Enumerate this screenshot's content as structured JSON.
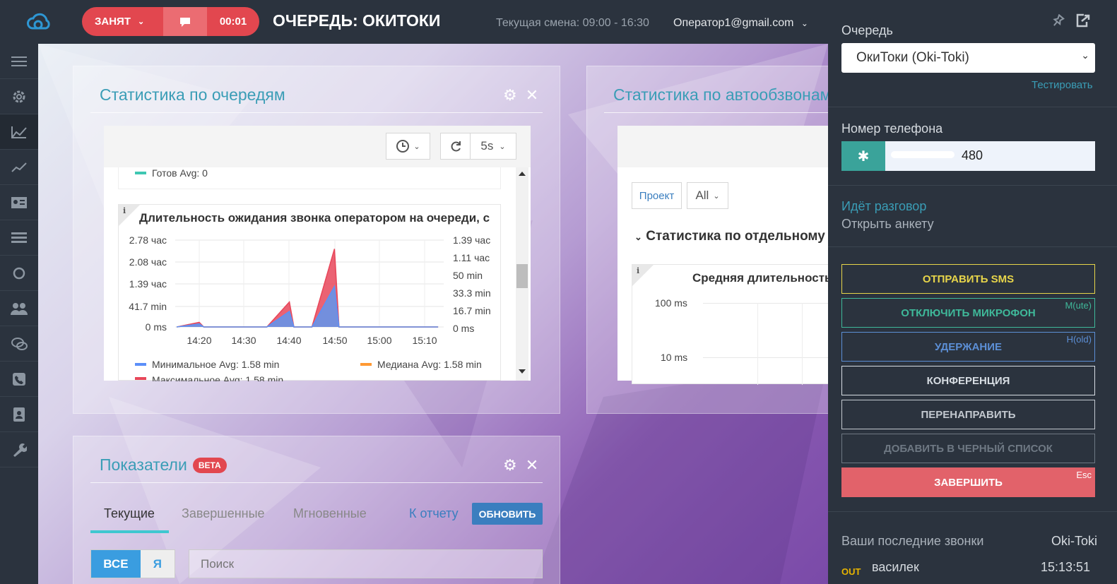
{
  "header": {
    "status_label": "ЗАНЯТ",
    "timer": "00:01",
    "queue_title": "ОЧЕРЕДЬ: ОКИТОКИ",
    "shift": "Текущая смена: 09:00 - 16:30",
    "user_email": "Оператор1@gmail.com"
  },
  "sidebar": {
    "items": [
      "menu-icon",
      "gear-icon",
      "area-chart-icon",
      "line-chart-icon",
      "id-card-icon",
      "list-icon",
      "circle-icon",
      "users-icon",
      "chat-icon",
      "phone-icon",
      "contact-book-icon",
      "wrench-icon"
    ]
  },
  "queue_stats": {
    "title": "Статистика по очередям",
    "refresh_interval": "5s",
    "ready_legend": "Готов  Avg: 0",
    "graph_title": "Длительность ожидания звонка оператором на очереди, с",
    "left_ticks": [
      "2.78 час",
      "2.08 час",
      "1.39 час",
      "41.7 min",
      "0 ms"
    ],
    "right_ticks": [
      "1.39 час",
      "1.11 час",
      "50 min",
      "33.3 min",
      "16.7 min",
      "0 ms"
    ],
    "x_ticks": [
      "14:20",
      "14:30",
      "14:40",
      "14:50",
      "15:00",
      "15:10"
    ],
    "legend_min": "Минимальное  Avg: 1.58 min",
    "legend_median": "Медиана  Avg: 1.58 min",
    "legend_max": "Максимальное  Avg: 1.58 min"
  },
  "chart_data": {
    "type": "line",
    "title": "Длительность ожидания звонка оператором на очереди, с",
    "x": [
      "14:15",
      "14:20",
      "14:21",
      "14:35",
      "14:40",
      "14:41",
      "14:45",
      "14:50",
      "14:51",
      "15:00",
      "15:10",
      "15:13"
    ],
    "series": [
      {
        "name": "Минимальное",
        "color": "#5b8ff9",
        "values": [
          0,
          0.1,
          0,
          0,
          0.5,
          0,
          0,
          1.3,
          0,
          0,
          0,
          0
        ]
      },
      {
        "name": "Медиана",
        "color": "#ff9933",
        "values": [
          0,
          0.1,
          0,
          0,
          0.5,
          0,
          0,
          1.3,
          0,
          0,
          0,
          0
        ]
      },
      {
        "name": "Максимальное",
        "color": "#e8475a",
        "values": [
          0,
          0.15,
          0,
          0,
          0.8,
          0,
          0,
          2.5,
          0,
          0,
          0,
          0
        ]
      }
    ],
    "ylabel": "час",
    "grid": true
  },
  "autodial_stats": {
    "title": "Статистика по автообзвонам",
    "project_label": "Проект",
    "project_value": "All",
    "section_title": "Статистика по отдельному",
    "graph_title": "Средняя длительность",
    "y_ticks": [
      "100 ms",
      "10 ms"
    ]
  },
  "indicators": {
    "title": "Показатели",
    "badge": "BETA",
    "tabs": [
      "Текущие",
      "Завершенные",
      "Мгновенные"
    ],
    "report_link": "К отчету",
    "refresh_btn": "ОБНОВИТЬ",
    "filter_all": "ВСЕ",
    "filter_me": "Я",
    "search_placeholder": "Поиск"
  },
  "right_panel": {
    "queue_label": "Очередь",
    "queue_value": "ОкиТоки (Oki-Toki)",
    "test_link": "Тестировать",
    "phone_label": "Номер телефона",
    "phone_value": "480",
    "talk_status": "Идёт разговор",
    "open_form": "Открыть анкету",
    "actions": [
      {
        "label": "ОТПРАВИТЬ SMS",
        "hotkey": "",
        "color": "#e7d54a"
      },
      {
        "label": "ОТКЛЮЧИТЬ МИКРОФОН",
        "hotkey": "M(ute)",
        "color": "#3fb99a"
      },
      {
        "label": "УДЕРЖАНИЕ",
        "hotkey": "H(old)",
        "color": "#5c8fd6"
      },
      {
        "label": "КОНФЕРЕНЦИЯ",
        "hotkey": "",
        "color": "#d7dde3"
      },
      {
        "label": "ПЕРЕНАПРАВИТЬ",
        "hotkey": "",
        "color": "#c2c8cf"
      },
      {
        "label": "ДОБАВИТЬ В ЧЕРНЫЙ СПИСОК",
        "hotkey": "",
        "color": "#6e7883"
      },
      {
        "label": "ЗАВЕРШИТЬ",
        "hotkey": "Esc",
        "color": "#e2626a"
      }
    ],
    "recent_label": "Ваши последние звонки",
    "recent_queue": "Oki-Toki",
    "recent_calls": [
      {
        "dir": "OUT",
        "name": "василек",
        "time": "15:13:51"
      }
    ]
  }
}
